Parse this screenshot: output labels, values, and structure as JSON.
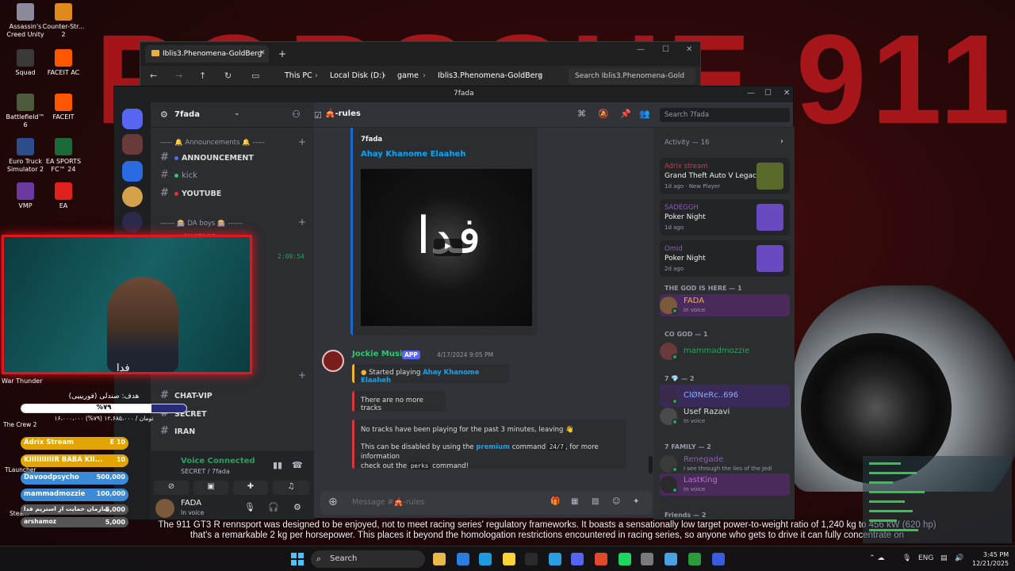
{
  "wallpaper": {
    "title_text": "PORSCHE 911"
  },
  "desktop_icons": [
    {
      "label": "Assassin's Creed Unity",
      "color": "#8a8a9a"
    },
    {
      "label": "Counter-Str... 2",
      "color": "#e08a1e"
    },
    {
      "label": "Squad",
      "color": "#3a3a3a"
    },
    {
      "label": "FACEIT AC",
      "color": "#ff5500"
    },
    {
      "label": "Battlefield™ 6",
      "color": "#4a5a3a"
    },
    {
      "label": "FACEIT",
      "color": "#ff5500"
    },
    {
      "label": "Euro Truck Simulator 2",
      "color": "#2c4c8c"
    },
    {
      "label": "EA SPORTS FC™ 24",
      "color": "#1a6a3a"
    },
    {
      "label": "VMP",
      "color": "#6a3aa0"
    },
    {
      "label": "EA",
      "color": "#e0201a"
    }
  ],
  "explorer": {
    "tab_title": "Iblis3.Phenomena-GoldBerg",
    "breadcrumbs": [
      "This PC",
      "Local Disk (D:)",
      "game",
      "Iblis3.Phenomena-GoldBerg"
    ],
    "search_placeholder": "Search Iblis3.Phenomena-Gold"
  },
  "discord": {
    "window_title": "7fada",
    "server_name": "7fada",
    "categories": [
      {
        "label": "----- 🔔 Announcements 🔔 -----"
      },
      {
        "label": "------ 🎰 DA boys 🎰 ------"
      }
    ],
    "channels": [
      {
        "name": "ANNOUNCEMENT",
        "dot": "#5865f2",
        "bold": true
      },
      {
        "name": "kick",
        "dot": "#2dc770",
        "bold": false
      },
      {
        "name": "YOUTUBE",
        "dot": "#da373c",
        "bold": true
      },
      {
        "name": "CHAT-VIP",
        "bold": true
      },
      {
        "name": "SECRET",
        "bold": true
      },
      {
        "name": "IRAN",
        "bold": true
      }
    ],
    "partial_channel": "CHAT-VIP",
    "timer": "2:08:54",
    "voice": {
      "status": "Voice Connected",
      "location": "SECRET / 7fada"
    },
    "user": {
      "name": "FADA",
      "status": "In voice"
    },
    "chat_channel": "🎪-rules",
    "search_placeholder": "Search 7fada",
    "embed": {
      "provider": "7fada",
      "title": "Ahay Khanome Elaaheh",
      "image_glyph": "فدا"
    },
    "message": {
      "author": "Jockie Music",
      "tag": "APP",
      "time": "4/17/2024 9:05 PM",
      "started_prefix": "Started playing",
      "started_track": "Ahay Khanome Elaaheh",
      "no_tracks": "There are no more tracks",
      "idle_line": "No tracks have been playing for the past 3 minutes, leaving 👋",
      "disable_a": "This can be disabled by using the",
      "premium": "premium",
      "disable_b": "command",
      "code_247": "24/7",
      "disable_c": ", for more information",
      "disable_d": "check out the",
      "code_perks": "perks",
      "disable_e": "command!"
    },
    "composer_placeholder": "Message #🎪-rules",
    "activity": {
      "header": "Activity — 16",
      "cards": [
        {
          "who": "Adrix stream",
          "who_color": "#da373c",
          "game": "Grand Theft Auto V Legacy",
          "meta": "1d ago · New Player",
          "img": "#5a6a2a"
        },
        {
          "who": "SADEGGH",
          "who_color": "#8f5ab5",
          "game": "Poker Night",
          "meta": "1d ago",
          "img": "#6a4ac0"
        },
        {
          "who": "Omid",
          "who_color": "#8f5ab5",
          "game": "Poker Night",
          "meta": "2d ago",
          "img": "#6a4ac0"
        }
      ],
      "groups": [
        {
          "label": "THE GOD IS HERE — 1"
        },
        {
          "label": "CO GOD — 1"
        },
        {
          "label": "7 💎 — 2"
        },
        {
          "label": "7 FAMILY — 2"
        },
        {
          "label": "Friends — 2"
        }
      ],
      "members": [
        {
          "name": "FADA",
          "status": "In voice",
          "color": "#f0b232",
          "av": "#7a5a3a"
        },
        {
          "name": "mammadmozzie",
          "status": "",
          "color": "#23a559",
          "av": "#6a3a3a"
        },
        {
          "name": "ClØNeRc..696",
          "status": "",
          "color": "#8fa8ff",
          "av": "#3a2a4a"
        },
        {
          "name": "Usef Razavi",
          "status": "In voice",
          "color": "#dbdee1",
          "av": "#4a4a4a"
        },
        {
          "name": "Renegade",
          "status": "I see through the lies of the Jedi",
          "color": "#8f5ab5",
          "av": "#3a3a3a"
        },
        {
          "name": "LastKing",
          "status": "In voice",
          "color": "#c06ad0",
          "av": "#2a2a2a"
        }
      ]
    }
  },
  "overlay": {
    "webcam_tag": "فدا",
    "goal": "هدف: صندلی (فوریییی)",
    "progress": 0.79,
    "progress_label": "%۷۹",
    "goal_sub": "۱۶،۰۰۰،۰۰۰ تومان / ۱۲،۶۸۵،۰۰۰ (۷۹%)",
    "side_label_top": "War Thunder",
    "side_label_crew": "The Crew 2",
    "side_label_launcher": "TLauncher",
    "side_label_steam": "Steam",
    "board": [
      {
        "name": "Adrix Stream",
        "amount": "E 10",
        "color": "#e2a400"
      },
      {
        "name": "KIIIIIIIIIIR BABA KII...",
        "amount": "10",
        "color": "#e2a400"
      },
      {
        "name": "Davoodpsycho",
        "amount": "500,000",
        "color": "#3a8ad8"
      },
      {
        "name": "mammadmozzie",
        "amount": "100,000",
        "color": "#3a8ad8"
      },
      {
        "name": "سازمان حمایت از استریم فدا",
        "amount": "5,000",
        "color": "#555"
      },
      {
        "name": "arshamoz",
        "amount": "5,000",
        "color": "#555"
      }
    ]
  },
  "subtitle": {
    "line1": "The 911 GT3 R rennsport was designed to be enjoyed, not to meet racing series' regulatory frameworks. It boasts a sensationally low target power-to-weight ratio of 1,240 kg to 456 kW (620 hp)",
    "line2": "that's a remarkable 2 kg per horsepower. This places it beyond the homologation restrictions encountered in racing series, so anyone who gets to drive it can fully concentrate on"
  },
  "taskbar": {
    "search_label": "Search",
    "lang": "ENG",
    "time": "3:45 PM",
    "date": "12/21/2025",
    "icons": [
      "#e9b84a",
      "#2b7de0",
      "#1e9be0",
      "#ffd23a",
      "#2a2a2a",
      "#2a9ee0",
      "#5865f2",
      "#e04a2a",
      "#1ed760",
      "#7a7a7a",
      "#4aa0e0",
      "#2a9a3a",
      "#3a5ae0"
    ]
  },
  "colors": {
    "accent": "#5865f2",
    "link": "#00a8fc",
    "online": "#23a559",
    "danger": "#da373c"
  }
}
